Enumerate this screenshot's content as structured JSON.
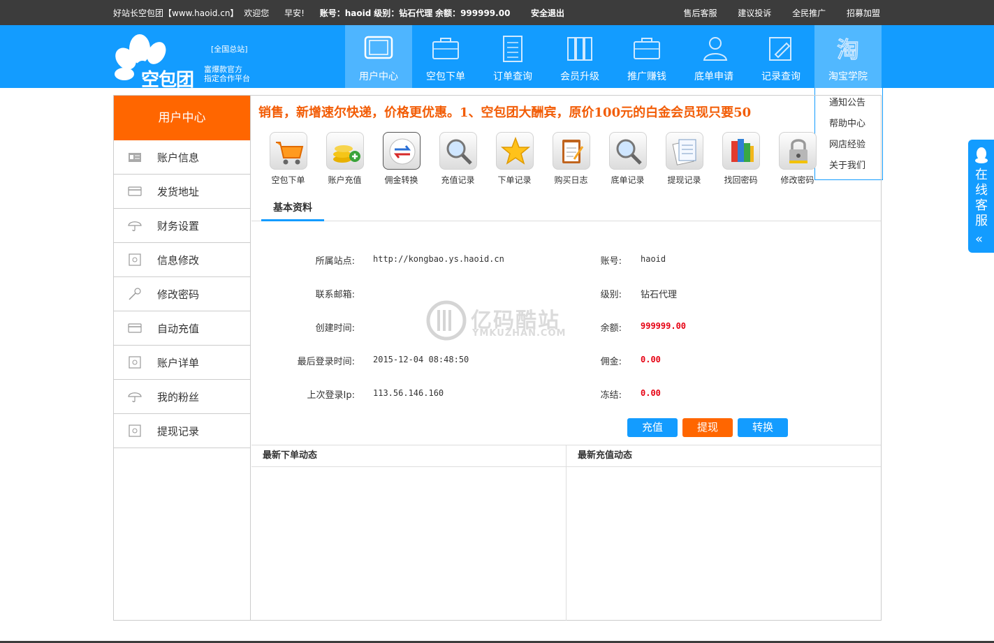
{
  "colors": {
    "accent_blue": "#139cff",
    "accent_orange": "#ff6600",
    "topbar": "#3c3c3c",
    "money_red": "#e60012"
  },
  "topbar": {
    "site_name": "好站长空包团【www.haoid.cn】",
    "welcome": "欢迎您",
    "greeting": "早安!",
    "account_label": "账号：",
    "account": "haoid",
    "level_label": "级别：",
    "level": "钻石代理",
    "balance_label": "余额：",
    "balance": "999999.00",
    "logout": "安全退出",
    "links": [
      "售后客服",
      "建议投诉",
      "全民推广",
      "招募加盟"
    ]
  },
  "logo": {
    "sub": "[全国总站]",
    "name": "空包团",
    "slogan_1": "富爆款官方",
    "slogan_2": "指定合作平台"
  },
  "nav": [
    {
      "label": "用户中心",
      "icon": "tablet-icon"
    },
    {
      "label": "空包下单",
      "icon": "briefcase-icon"
    },
    {
      "label": "订单查询",
      "icon": "document-icon"
    },
    {
      "label": "会员升级",
      "icon": "books-icon"
    },
    {
      "label": "推广赚钱",
      "icon": "briefcase-icon"
    },
    {
      "label": "底单申请",
      "icon": "users-icon"
    },
    {
      "label": "记录查询",
      "icon": "edit-icon"
    },
    {
      "label": "淘宝学院",
      "icon": "taobao-icon"
    }
  ],
  "dropdown": [
    "通知公告",
    "帮助中心",
    "网店经验",
    "关于我们"
  ],
  "sidebar": {
    "title": "用户中心",
    "items": [
      {
        "label": "账户信息",
        "icon": "id-card-icon"
      },
      {
        "label": "发货地址",
        "icon": "card-icon"
      },
      {
        "label": "财务设置",
        "icon": "umbrella-icon"
      },
      {
        "label": "信息修改",
        "icon": "safe-icon"
      },
      {
        "label": "修改密码",
        "icon": "key-icon"
      },
      {
        "label": "自动充值",
        "icon": "card-icon"
      },
      {
        "label": "账户详单",
        "icon": "safe-icon"
      },
      {
        "label": "我的粉丝",
        "icon": "umbrella-icon"
      },
      {
        "label": "提现记录",
        "icon": "safe-icon"
      }
    ]
  },
  "marquee": "销售，新增速尔快递，价格更优惠。1、空包团大酬宾，原价100元的白金会员现只要50",
  "quick": [
    {
      "label": "空包下单",
      "icon": "cart-icon"
    },
    {
      "label": "账户充值",
      "icon": "coins-icon"
    },
    {
      "label": "佣金转换",
      "icon": "exchange-icon"
    },
    {
      "label": "充值记录",
      "icon": "magnifier-icon"
    },
    {
      "label": "下单记录",
      "icon": "star-icon"
    },
    {
      "label": "购买日志",
      "icon": "clipboard-icon"
    },
    {
      "label": "底单记录",
      "icon": "magnifier-icon"
    },
    {
      "label": "提现记录",
      "icon": "notes-icon"
    },
    {
      "label": "找回密码",
      "icon": "books-icon"
    },
    {
      "label": "修改密码",
      "icon": "padlock-icon"
    }
  ],
  "tab": "基本资料",
  "info": {
    "left": [
      {
        "label": "所属站点:",
        "value": "http://kongbao.ys.haoid.cn"
      },
      {
        "label": "联系邮箱:",
        "value": ""
      },
      {
        "label": "创建时间:",
        "value": ""
      },
      {
        "label": "最后登录时间:",
        "value": "2015-12-04 08:48:50"
      },
      {
        "label": "上次登录Ip:",
        "value": "113.56.146.160"
      }
    ],
    "right": [
      {
        "label": "账号:",
        "value": "haoid"
      },
      {
        "label": "级别:",
        "value": "钻石代理"
      },
      {
        "label": "余额:",
        "value": "999999.00"
      },
      {
        "label": "佣金:",
        "value": "0.00"
      },
      {
        "label": "冻结:",
        "value": "0.00"
      }
    ]
  },
  "buttons": {
    "recharge": "充值",
    "withdraw": "提现",
    "convert": "转换"
  },
  "activity": {
    "orders_title": "最新下单动态",
    "recharge_title": "最新充值动态"
  },
  "watermark": {
    "text": "亿码酷站",
    "sub": "YMKUZHAN.COM"
  },
  "service": {
    "text": "在线客服"
  }
}
